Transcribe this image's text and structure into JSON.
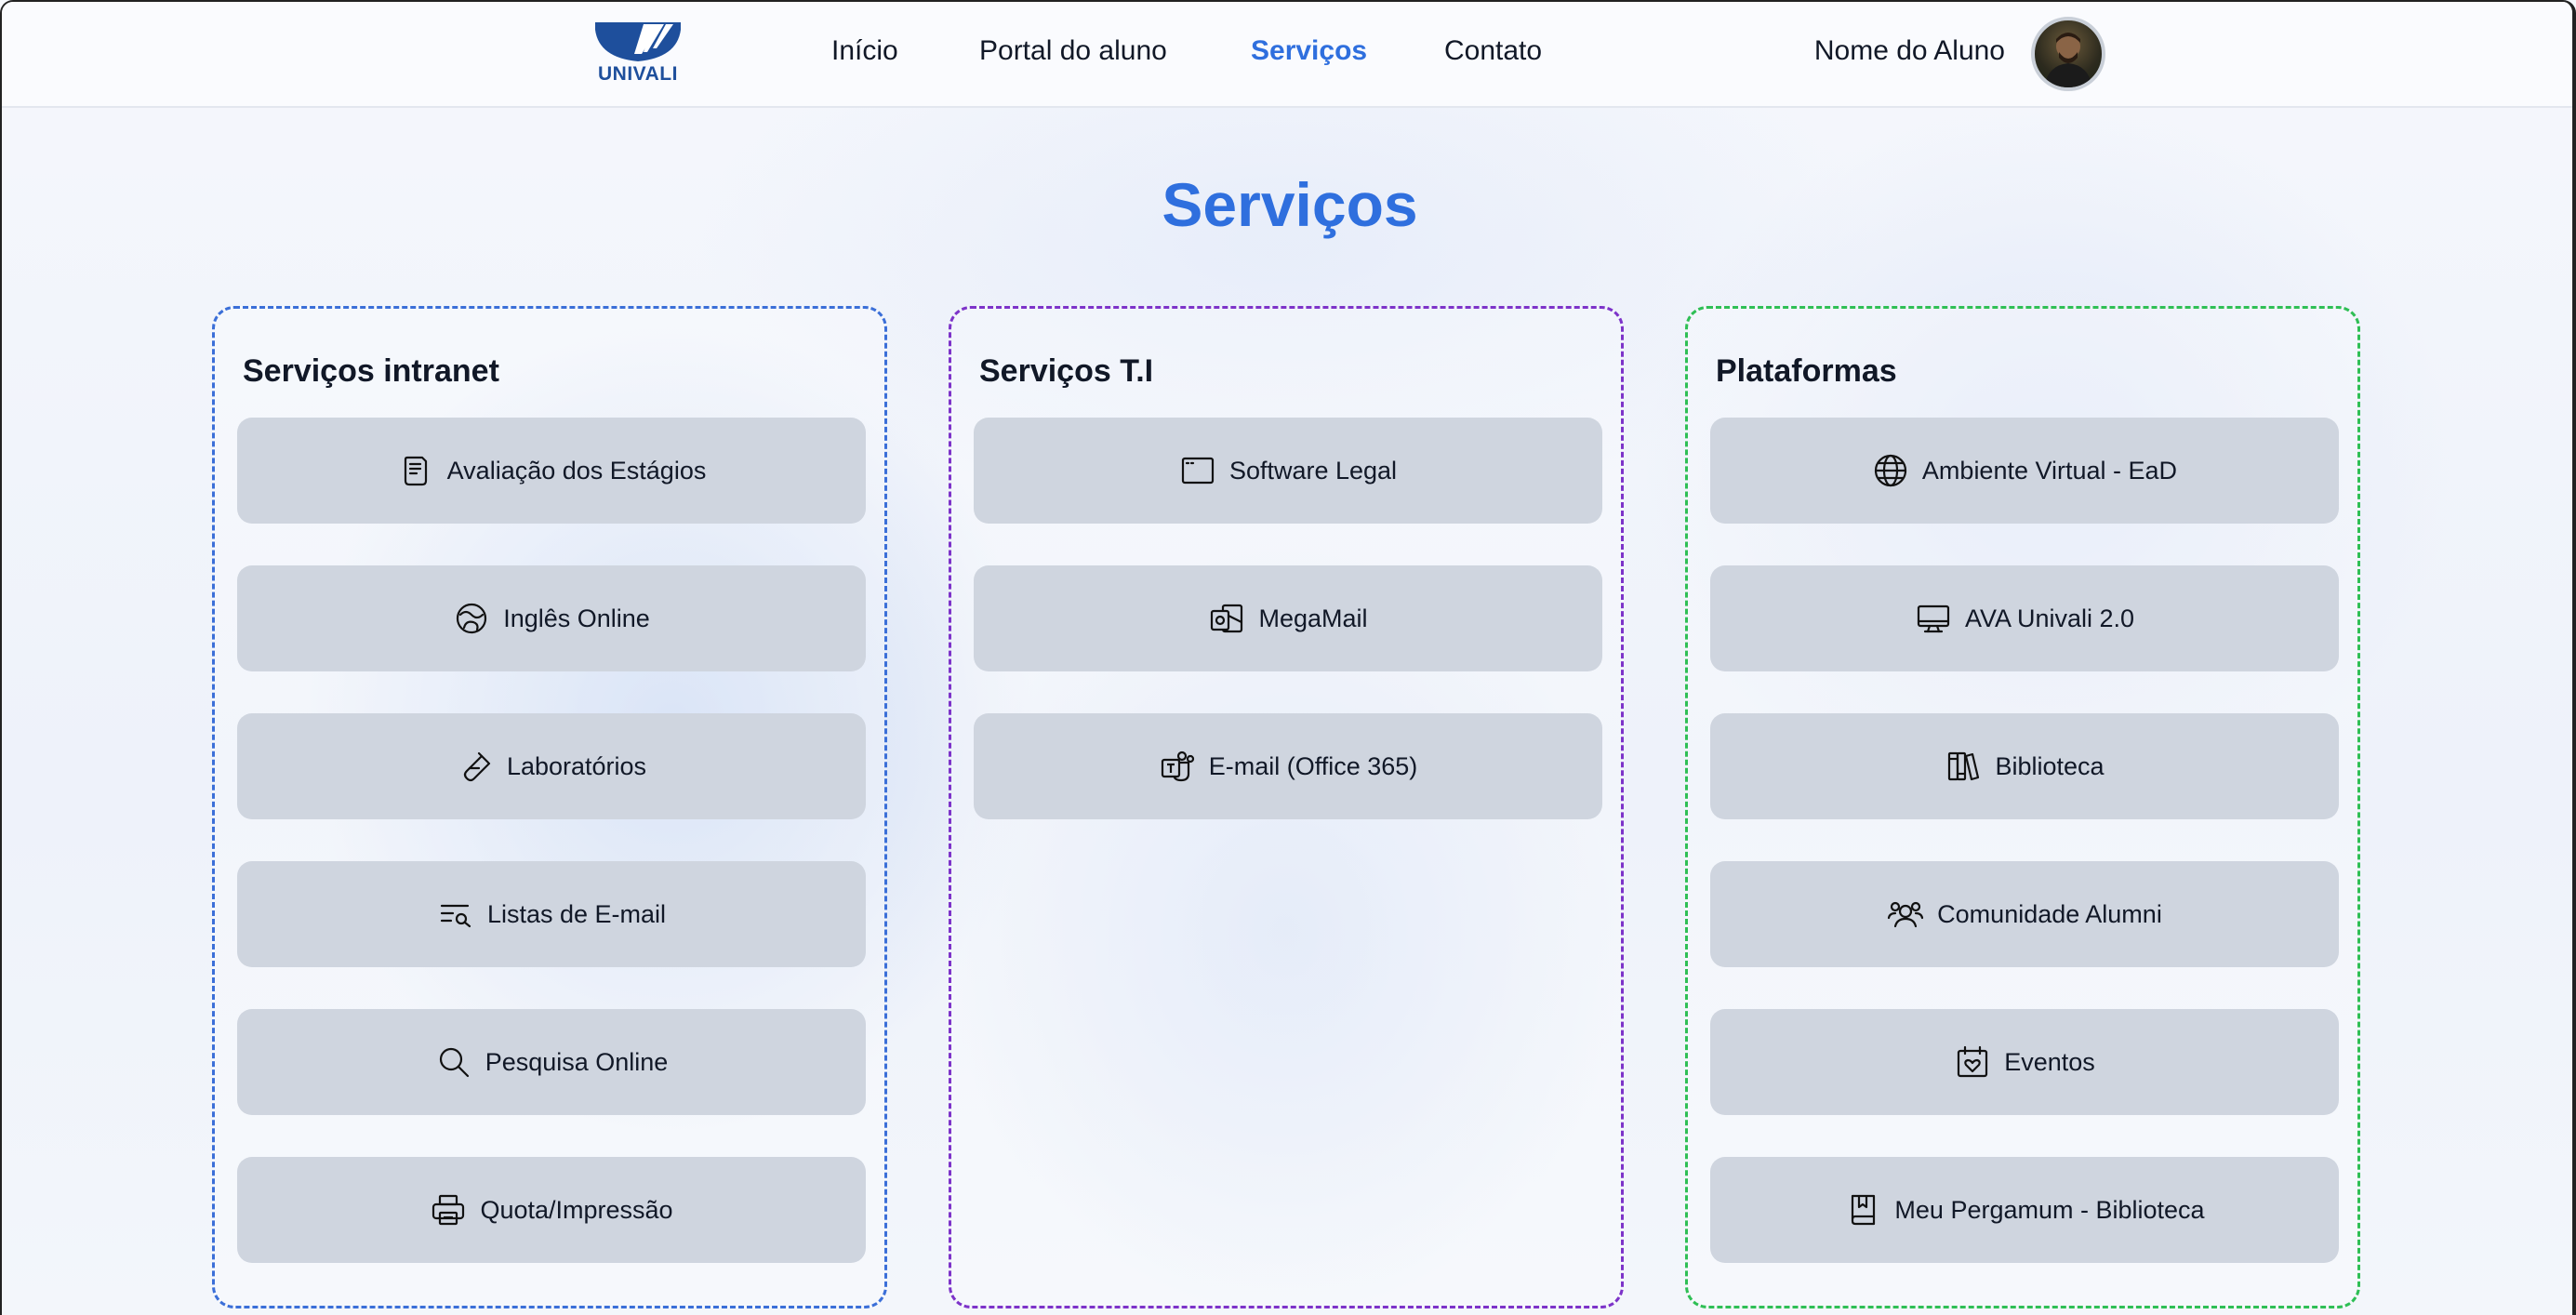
{
  "header": {
    "logo_text": "UNIVALI",
    "nav": [
      {
        "label": "Início",
        "active": false
      },
      {
        "label": "Portal do aluno",
        "active": false
      },
      {
        "label": "Serviços",
        "active": true
      },
      {
        "label": "Contato",
        "active": false
      }
    ],
    "user_name": "Nome do Aluno"
  },
  "page": {
    "title": "Serviços"
  },
  "sections": [
    {
      "title": "Serviços intranet",
      "border_color": "#3b6fd8",
      "items": [
        {
          "label": "Avaliação dos Estágios",
          "icon": "document-icon"
        },
        {
          "label": "Inglês Online",
          "icon": "globe-swirl-icon"
        },
        {
          "label": "Laboratórios",
          "icon": "test-tube-icon"
        },
        {
          "label": "Listas de E-mail",
          "icon": "list-search-icon"
        },
        {
          "label": "Pesquisa Online",
          "icon": "search-icon"
        },
        {
          "label": "Quota/Impressão",
          "icon": "printer-icon"
        }
      ]
    },
    {
      "title": "Serviços T.I",
      "border_color": "#7d33c9",
      "items": [
        {
          "label": "Software Legal",
          "icon": "window-icon"
        },
        {
          "label": "MegaMail",
          "icon": "outlook-icon"
        },
        {
          "label": "E-mail (Office 365)",
          "icon": "teams-icon"
        }
      ]
    },
    {
      "title": "Plataformas",
      "border_color": "#2fbf55",
      "items": [
        {
          "label": "Ambiente Virtual - EaD",
          "icon": "globe-icon"
        },
        {
          "label": "AVA Univali 2.0",
          "icon": "monitor-icon"
        },
        {
          "label": "Biblioteca",
          "icon": "books-icon"
        },
        {
          "label": "Comunidade Alumni",
          "icon": "users-icon"
        },
        {
          "label": "Eventos",
          "icon": "calendar-heart-icon"
        },
        {
          "label": "Meu Pergamum - Biblioteca",
          "icon": "bookmark-book-icon"
        }
      ]
    }
  ]
}
